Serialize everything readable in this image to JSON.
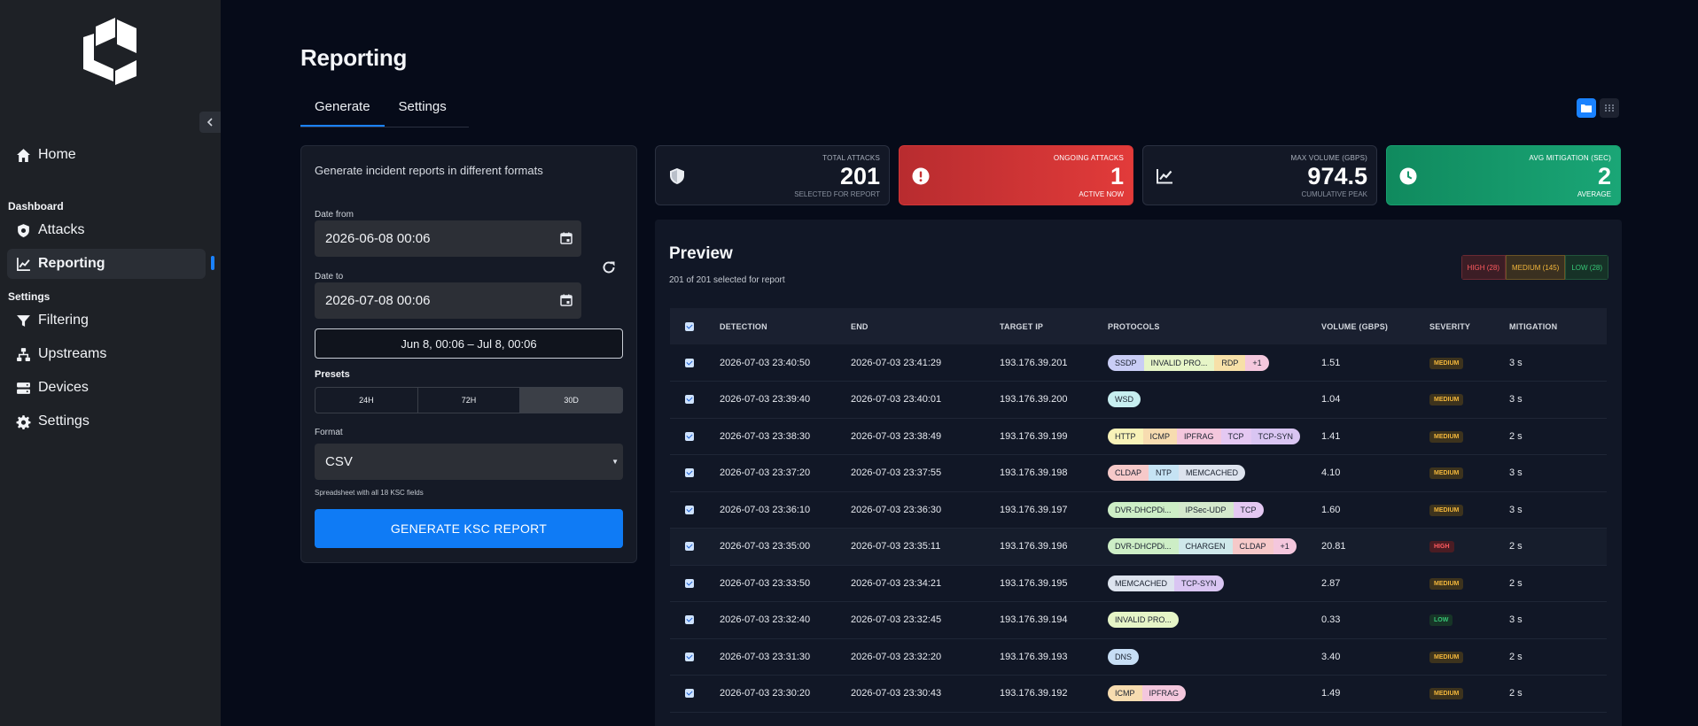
{
  "sidebar": {
    "items": {
      "home": "Home",
      "attacks": "Attacks",
      "reporting": "Reporting",
      "filtering": "Filtering",
      "upstreams": "Upstreams",
      "devices": "Devices",
      "settings": "Settings"
    },
    "sections": {
      "dashboard": "Dashboard",
      "settings": "Settings"
    }
  },
  "header": {
    "title": "Reporting",
    "tabs": [
      "Generate",
      "Settings"
    ]
  },
  "form": {
    "description": "Generate incident reports in different formats",
    "date_from_label": "Date from",
    "date_from": "2026-06-08 00:06",
    "date_to_label": "Date to",
    "date_to": "2026-07-08 00:06",
    "range_summary": "Jun 8, 00:06 – Jul 8, 00:06",
    "presets_label": "Presets",
    "presets": [
      "24H",
      "72H",
      "30D"
    ],
    "active_preset": "30D",
    "format_label": "Format",
    "format_value": "CSV",
    "format_hint": "Spreadsheet with all 18 KSC fields",
    "generate_label": "GENERATE KSC REPORT"
  },
  "stats": [
    {
      "label": "TOTAL ATTACKS",
      "value": "201",
      "sub": "SELECTED FOR REPORT"
    },
    {
      "label": "ONGOING ATTACKS",
      "value": "1",
      "sub": "ACTIVE NOW"
    },
    {
      "label": "MAX VOLUME (GBPS)",
      "value": "974.5",
      "sub": "CUMULATIVE PEAK"
    },
    {
      "label": "AVG MITIGATION (SEC)",
      "value": "2",
      "sub": "AVERAGE"
    }
  ],
  "colors": {
    "accent": "#1a82ff",
    "danger": "#d43636",
    "success": "#17a06f"
  },
  "preview": {
    "title": "Preview",
    "subtitle": "201 of 201 selected for report",
    "legend": {
      "high": "HIGH (28)",
      "medium": "MEDIUM (145)",
      "low": "LOW (28)"
    },
    "columns": [
      "DETECTION",
      "END",
      "TARGET IP",
      "PROTOCOLS",
      "VOLUME (GBPS)",
      "SEVERITY",
      "MITIGATION"
    ],
    "rows": [
      {
        "detection": "2026-07-03 23:40:50",
        "end": "2026-07-03 23:41:29",
        "ip": "193.176.39.201",
        "protocols": [
          "SSDP",
          "INVALID PRO...",
          "RDP",
          "+1"
        ],
        "volume": "1.51",
        "severity": "MEDIUM",
        "mitigation": "3 s"
      },
      {
        "detection": "2026-07-03 23:39:40",
        "end": "2026-07-03 23:40:01",
        "ip": "193.176.39.200",
        "protocols": [
          "WSD"
        ],
        "volume": "1.04",
        "severity": "MEDIUM",
        "mitigation": "3 s"
      },
      {
        "detection": "2026-07-03 23:38:30",
        "end": "2026-07-03 23:38:49",
        "ip": "193.176.39.199",
        "protocols": [
          "HTTP",
          "ICMP",
          "IPFRAG",
          "TCP",
          "TCP-SYN"
        ],
        "volume": "1.41",
        "severity": "MEDIUM",
        "mitigation": "2 s"
      },
      {
        "detection": "2026-07-03 23:37:20",
        "end": "2026-07-03 23:37:55",
        "ip": "193.176.39.198",
        "protocols": [
          "CLDAP",
          "NTP",
          "MEMCACHED"
        ],
        "volume": "4.10",
        "severity": "MEDIUM",
        "mitigation": "3 s"
      },
      {
        "detection": "2026-07-03 23:36:10",
        "end": "2026-07-03 23:36:30",
        "ip": "193.176.39.197",
        "protocols": [
          "DVR-DHCPDi...",
          "IPSec-UDP",
          "TCP"
        ],
        "volume": "1.60",
        "severity": "MEDIUM",
        "mitigation": "3 s"
      },
      {
        "detection": "2026-07-03 23:35:00",
        "end": "2026-07-03 23:35:11",
        "ip": "193.176.39.196",
        "protocols": [
          "DVR-DHCPDi...",
          "CHARGEN",
          "CLDAP",
          "+1"
        ],
        "volume": "20.81",
        "severity": "HIGH",
        "mitigation": "2 s"
      },
      {
        "detection": "2026-07-03 23:33:50",
        "end": "2026-07-03 23:34:21",
        "ip": "193.176.39.195",
        "protocols": [
          "MEMCACHED",
          "TCP-SYN"
        ],
        "volume": "2.87",
        "severity": "MEDIUM",
        "mitigation": "2 s"
      },
      {
        "detection": "2026-07-03 23:32:40",
        "end": "2026-07-03 23:32:45",
        "ip": "193.176.39.194",
        "protocols": [
          "INVALID PRO..."
        ],
        "volume": "0.33",
        "severity": "LOW",
        "mitigation": "3 s"
      },
      {
        "detection": "2026-07-03 23:31:30",
        "end": "2026-07-03 23:32:20",
        "ip": "193.176.39.193",
        "protocols": [
          "DNS"
        ],
        "volume": "3.40",
        "severity": "MEDIUM",
        "mitigation": "2 s"
      },
      {
        "detection": "2026-07-03 23:30:20",
        "end": "2026-07-03 23:30:43",
        "ip": "193.176.39.192",
        "protocols": [
          "ICMP",
          "IPFRAG"
        ],
        "volume": "1.49",
        "severity": "MEDIUM",
        "mitigation": "2 s"
      }
    ]
  },
  "protocol_colors": {
    "SSDP": "#c9cdf5",
    "INVALID PRO...": "#e6f5c7",
    "RDP": "#f7e0a8",
    "+1": "#f4c7dd",
    "WSD": "#c7eef0",
    "HTTP": "#f8f2b8",
    "ICMP": "#f7dcb0",
    "IPFRAG": "#f4c7dd",
    "TCP": "#e4c8f2",
    "TCP-SYN": "#d9c5f2",
    "CLDAP": "#f6c9c9",
    "NTP": "#c6e3f4",
    "MEMCACHED": "#dde3ee",
    "DVR-DHCPDi...": "#cdeec6",
    "IPSec-UDP": "#d4e8cc",
    "CHARGEN": "#cfe8ea",
    "DNS": "#c7def5"
  }
}
